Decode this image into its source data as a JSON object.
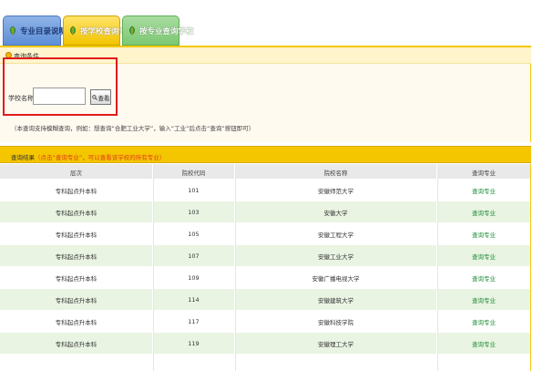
{
  "tabs": [
    {
      "label": "专业目录说明",
      "color": "#5d8fd8"
    },
    {
      "label": "按学校查询专业",
      "color": "#f2c400",
      "active": true
    },
    {
      "label": "按专业查询学校",
      "color": "#7cc873"
    }
  ],
  "query": {
    "header": "查询条件",
    "field_label": "学校名称",
    "input_value": "",
    "button_label": "查看",
    "hint": "（本查询支持模糊查询，例如：想查询“合肥工业大学”，输入“工业”后点击“查询”按钮即可）"
  },
  "results": {
    "header_prefix": "查询结果",
    "header_note": "（点击“查询专业”，可以查看该学校的所有专业）",
    "columns": [
      "层次",
      "院校代码",
      "院校名称",
      "查询专业"
    ],
    "rows": [
      {
        "level": "专科起点升本科",
        "code": "101",
        "name": "安徽师范大学",
        "action": "查询专业"
      },
      {
        "level": "专科起点升本科",
        "code": "103",
        "name": "安徽大学",
        "action": "查询专业"
      },
      {
        "level": "专科起点升本科",
        "code": "105",
        "name": "安徽工程大学",
        "action": "查询专业"
      },
      {
        "level": "专科起点升本科",
        "code": "107",
        "name": "安徽工业大学",
        "action": "查询专业"
      },
      {
        "level": "专科起点升本科",
        "code": "109",
        "name": "安徽广播电视大学",
        "action": "查询专业"
      },
      {
        "level": "专科起点升本科",
        "code": "114",
        "name": "安徽建筑大学",
        "action": "查询专业"
      },
      {
        "level": "专科起点升本科",
        "code": "117",
        "name": "安徽科技学院",
        "action": "查询专业"
      },
      {
        "level": "专科起点升本科",
        "code": "119",
        "name": "安徽理工大学",
        "action": "查询专业"
      }
    ]
  },
  "colors": {
    "accent_yellow": "#f4c600",
    "row_alt": "#e9f4e2",
    "link_green": "#1f8d3a",
    "highlight_red": "#e01b1b"
  }
}
